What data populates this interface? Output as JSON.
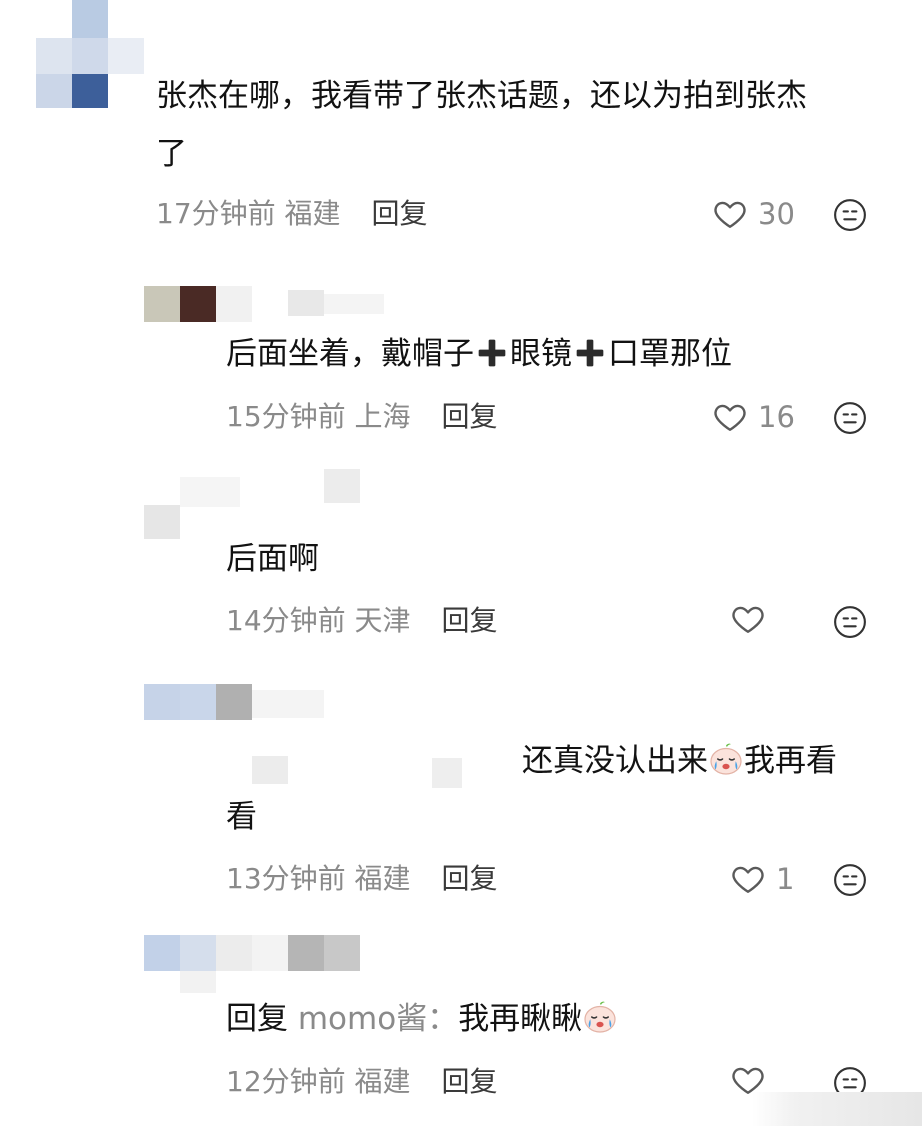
{
  "comments": [
    {
      "text_line1": "张杰在哪，我看带了张杰话题，还以为拍到张杰",
      "text_line2": "了",
      "time": "17分钟前",
      "location": "福建",
      "reply_label": "回复",
      "likes": "30"
    },
    {
      "text_part1": "后面坐着，戴帽子",
      "text_part2": "眼镜",
      "text_part3": "口罩那位",
      "time": "15分钟前",
      "location": "上海",
      "reply_label": "回复",
      "likes": "16"
    },
    {
      "text": "后面啊",
      "time": "14分钟前",
      "location": "天津",
      "reply_label": "回复",
      "likes": ""
    },
    {
      "text_part1": "还真没认出来",
      "text_part2": "我再看",
      "text_line2": "看",
      "time": "13分钟前",
      "location": "福建",
      "reply_label": "回复",
      "likes": "1"
    },
    {
      "reply_prefix": "回复",
      "reply_to": "momo酱：",
      "text": "我再瞅瞅",
      "time": "12分钟前",
      "location": "福建",
      "reply_label": "回复",
      "likes": ""
    }
  ],
  "icons": {
    "like": "heart-outline-icon",
    "more": "neutral-face-icon",
    "plus": "heavy-plus-emoji",
    "crying": "crying-face-emoji"
  },
  "colors": {
    "text": "#121212",
    "meta": "#8a8a8a",
    "reply": "#3a3a3a"
  }
}
